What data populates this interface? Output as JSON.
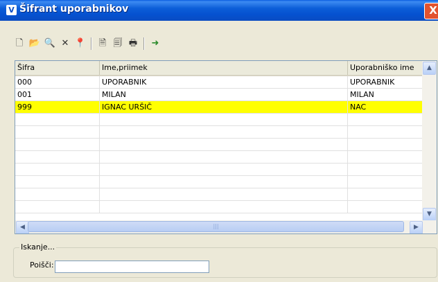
{
  "window": {
    "title": "Šifrant uporabnikov",
    "app_icon_letter": "V",
    "close_label": "X"
  },
  "toolbar": {
    "buttons": [
      {
        "icon": "new-document-icon",
        "glyph": "🗋"
      },
      {
        "icon": "open-folder-icon",
        "glyph": "📂"
      },
      {
        "icon": "search-preview-icon",
        "glyph": "🔍"
      },
      {
        "icon": "delete-icon",
        "glyph": "✕"
      },
      {
        "icon": "pin-icon",
        "glyph": "📍"
      },
      {
        "icon": "print-preview-icon",
        "glyph": "🗎"
      },
      {
        "icon": "page-setup-icon",
        "glyph": "🗐"
      },
      {
        "icon": "printer-icon",
        "glyph": "🖶"
      },
      {
        "icon": "exit-icon",
        "glyph": "➜"
      }
    ]
  },
  "grid": {
    "columns": [
      "Šifra",
      "Ime,priimek",
      "Uporabniško ime"
    ],
    "rows": [
      [
        "000",
        "UPORABNIK",
        "UPORABNIK"
      ],
      [
        "001",
        "MILAN",
        "MILAN"
      ],
      [
        "999",
        "IGNAC URŠIČ",
        "NAC"
      ]
    ],
    "selected_row": 2,
    "selected_color": "#ffff00"
  },
  "search": {
    "legend": "Iskanje...",
    "label": "Poišči:",
    "value": ""
  }
}
